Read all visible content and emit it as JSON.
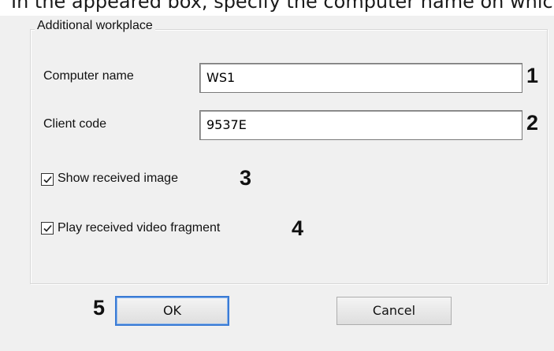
{
  "caption": "In the appeared box, specify the computer name on which the A",
  "groupbox": {
    "title": "Additional workplace"
  },
  "computer_name": {
    "label": "Computer name",
    "value": "WS1",
    "callout": "1"
  },
  "client_code": {
    "label": "Client code",
    "value": "9537E",
    "callout": "2"
  },
  "show_image": {
    "label": "Show received image",
    "checked": true,
    "callout": "3"
  },
  "play_video": {
    "label": "Play received video fragment",
    "checked": true,
    "callout": "4"
  },
  "buttons": {
    "ok_label": "OK",
    "ok_callout": "5",
    "cancel_label": "Cancel"
  },
  "colors": {
    "dialog_bg": "#f0f0f0",
    "default_button_border": "#3a7bd5"
  }
}
